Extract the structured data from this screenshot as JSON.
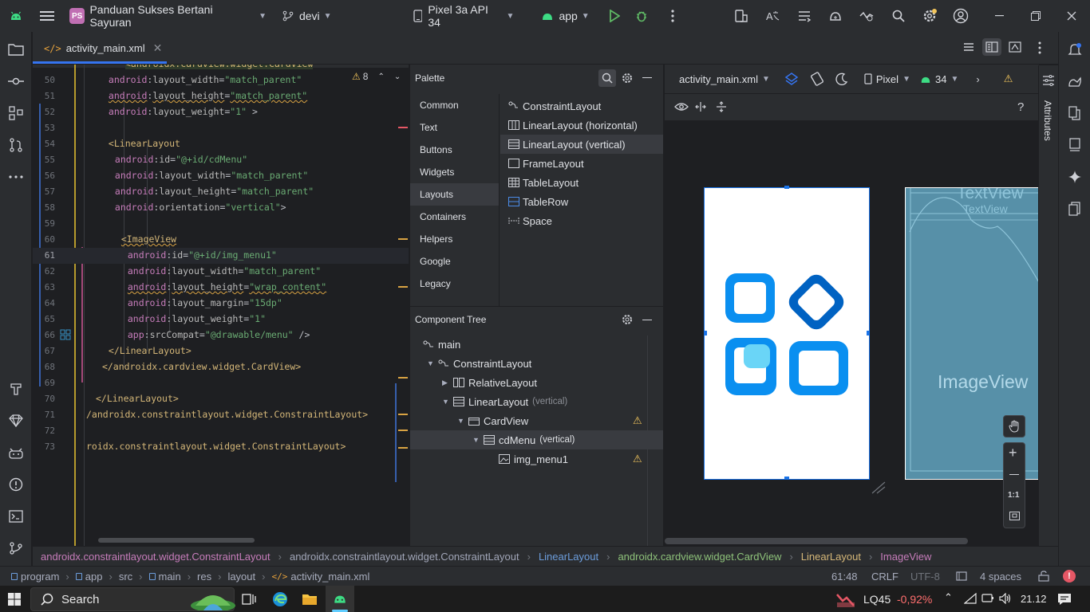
{
  "titlebar": {
    "project_badge": "PS",
    "project_name": "Panduan Sukses Bertani Sayuran",
    "branch": "devi",
    "device": "Pixel 3a API 34",
    "run_config": "app"
  },
  "tabs": [
    {
      "label": "activity_main.xml"
    }
  ],
  "editor": {
    "warning_count": "8",
    "lines": [
      {
        "num": "50",
        "indent": 7,
        "parts": [
          [
            "ns",
            "android"
          ],
          [
            "pl",
            ":"
          ],
          [
            "attr",
            "layout_width"
          ],
          [
            "pl",
            "="
          ],
          [
            "val",
            "\"match_parent\""
          ]
        ]
      },
      {
        "num": "51",
        "indent": 7,
        "squig": true,
        "parts": [
          [
            "ns",
            "android"
          ],
          [
            "pl",
            ":"
          ],
          [
            "attr",
            "layout_height"
          ],
          [
            "pl",
            "="
          ],
          [
            "val",
            "\"match_parent\""
          ]
        ]
      },
      {
        "num": "52",
        "indent": 7,
        "parts": [
          [
            "ns",
            "android"
          ],
          [
            "pl",
            ":"
          ],
          [
            "attr",
            "layout_weight"
          ],
          [
            "pl",
            "="
          ],
          [
            "val",
            "\"1\""
          ],
          [
            "pl",
            " >"
          ]
        ]
      },
      {
        "num": "53",
        "indent": 0,
        "parts": []
      },
      {
        "num": "54",
        "indent": 7,
        "parts": [
          [
            "tag",
            "<LinearLayout"
          ]
        ]
      },
      {
        "num": "55",
        "indent": 9,
        "parts": [
          [
            "ns",
            "android"
          ],
          [
            "pl",
            ":"
          ],
          [
            "attr",
            "id"
          ],
          [
            "pl",
            "="
          ],
          [
            "val",
            "\"@+id/cdMenu\""
          ]
        ]
      },
      {
        "num": "56",
        "indent": 9,
        "parts": [
          [
            "ns",
            "android"
          ],
          [
            "pl",
            ":"
          ],
          [
            "attr",
            "layout_width"
          ],
          [
            "pl",
            "="
          ],
          [
            "val",
            "\"match_parent\""
          ]
        ]
      },
      {
        "num": "57",
        "indent": 9,
        "parts": [
          [
            "ns",
            "android"
          ],
          [
            "pl",
            ":"
          ],
          [
            "attr",
            "layout_height"
          ],
          [
            "pl",
            "="
          ],
          [
            "val",
            "\"match_parent\""
          ]
        ]
      },
      {
        "num": "58",
        "indent": 9,
        "parts": [
          [
            "ns",
            "android"
          ],
          [
            "pl",
            ":"
          ],
          [
            "attr",
            "orientation"
          ],
          [
            "pl",
            "="
          ],
          [
            "val",
            "\"vertical\""
          ],
          [
            "pl",
            ">"
          ]
        ]
      },
      {
        "num": "59",
        "indent": 0,
        "parts": []
      },
      {
        "num": "60",
        "indent": 11,
        "squig": true,
        "parts": [
          [
            "tag",
            "<ImageView"
          ]
        ]
      },
      {
        "num": "61",
        "indent": 13,
        "parts": [
          [
            "ns",
            "android"
          ],
          [
            "pl",
            ":"
          ],
          [
            "attr",
            "id"
          ],
          [
            "pl",
            "="
          ],
          [
            "val",
            "\"@+id/img_menu1\""
          ]
        ]
      },
      {
        "num": "62",
        "indent": 13,
        "parts": [
          [
            "ns",
            "android"
          ],
          [
            "pl",
            ":"
          ],
          [
            "attr",
            "layout_width"
          ],
          [
            "pl",
            "="
          ],
          [
            "val",
            "\"match_parent\""
          ]
        ]
      },
      {
        "num": "63",
        "indent": 13,
        "squig": true,
        "parts": [
          [
            "ns",
            "android"
          ],
          [
            "pl",
            ":"
          ],
          [
            "attr",
            "layout_height"
          ],
          [
            "pl",
            "="
          ],
          [
            "val",
            "\"wrap_content\""
          ]
        ]
      },
      {
        "num": "64",
        "indent": 13,
        "parts": [
          [
            "ns",
            "android"
          ],
          [
            "pl",
            ":"
          ],
          [
            "attr",
            "layout_margin"
          ],
          [
            "pl",
            "="
          ],
          [
            "val",
            "\"15dp\""
          ]
        ]
      },
      {
        "num": "65",
        "indent": 13,
        "parts": [
          [
            "ns",
            "android"
          ],
          [
            "pl",
            ":"
          ],
          [
            "attr",
            "layout_weight"
          ],
          [
            "pl",
            "="
          ],
          [
            "val",
            "\"1\""
          ]
        ]
      },
      {
        "num": "66",
        "indent": 13,
        "parts": [
          [
            "ns",
            "app"
          ],
          [
            "pl",
            ":"
          ],
          [
            "attr",
            "srcCompat"
          ],
          [
            "pl",
            "="
          ],
          [
            "val",
            "\"@drawable/menu\""
          ],
          [
            "pl",
            " />"
          ]
        ]
      },
      {
        "num": "67",
        "indent": 7,
        "parts": [
          [
            "tag",
            "</LinearLayout>"
          ]
        ]
      },
      {
        "num": "68",
        "indent": 5,
        "parts": [
          [
            "tag",
            "</androidx.cardview.widget.CardView>"
          ]
        ]
      },
      {
        "num": "69",
        "indent": 0,
        "parts": []
      },
      {
        "num": "70",
        "indent": 3,
        "parts": [
          [
            "tag",
            "</LinearLayout>"
          ]
        ]
      },
      {
        "num": "71",
        "indent": 0,
        "parts": [
          [
            "tag",
            "/androidx.constraintlayout.widget.ConstraintLayout>"
          ]
        ]
      },
      {
        "num": "72",
        "indent": 0,
        "parts": []
      },
      {
        "num": "73",
        "indent": 0,
        "parts": [
          [
            "tag",
            "roidx.constraintlayout.widget.ConstraintLayout>"
          ]
        ]
      }
    ]
  },
  "palette": {
    "title": "Palette",
    "categories": [
      "Common",
      "Text",
      "Buttons",
      "Widgets",
      "Layouts",
      "Containers",
      "Helpers",
      "Google",
      "Legacy"
    ],
    "selected_category": "Layouts",
    "items": [
      "ConstraintLayout",
      "LinearLayout (horizontal)",
      "LinearLayout (vertical)",
      "FrameLayout",
      "TableLayout",
      "TableRow",
      "Space"
    ],
    "selected_item": "LinearLayout (vertical)"
  },
  "component_tree": {
    "title": "Component Tree",
    "rows": [
      {
        "label": "main",
        "sub": ""
      },
      {
        "label": "ConstraintLayout",
        "sub": ""
      },
      {
        "label": "RelativeLayout",
        "sub": ""
      },
      {
        "label": "LinearLayout",
        "sub": "(vertical)"
      },
      {
        "label": "CardView",
        "sub": ""
      },
      {
        "label": "cdMenu",
        "sub": "(vertical)"
      },
      {
        "label": "img_menu1",
        "sub": ""
      }
    ]
  },
  "design": {
    "file": "activity_main.xml",
    "device": "Pixel",
    "api": "34",
    "blueprint_text_1": "TextView",
    "blueprint_text_2": "TextView",
    "blueprint_image": "ImageView",
    "zoom_reset": "1:1"
  },
  "breadcrumbs": [
    "androidx.constraintlayout.widget.ConstraintLayout",
    "androidx.constraintlayout.widget.ConstraintLayout",
    "LinearLayout",
    "androidx.cardview.widget.CardView",
    "LinearLayout",
    "ImageView"
  ],
  "statusbar": {
    "path": [
      "program",
      "app",
      "src",
      "main",
      "res",
      "layout",
      "activity_main.xml"
    ],
    "position": "61:48",
    "line_sep": "CRLF",
    "encoding": "UTF-8",
    "indent": "4 spaces"
  },
  "taskbar": {
    "search": "Search",
    "stock_name": "LQ45",
    "stock_change": "-0,92%",
    "time": "21.12"
  },
  "side_labels": {
    "attributes": "Attributes"
  },
  "colors": {
    "accent": "#3574f0",
    "warning": "#f2c55c",
    "error": "#e55765",
    "icon_blue": "#0a8ff0",
    "icon_dark_blue": "#0062c2"
  }
}
